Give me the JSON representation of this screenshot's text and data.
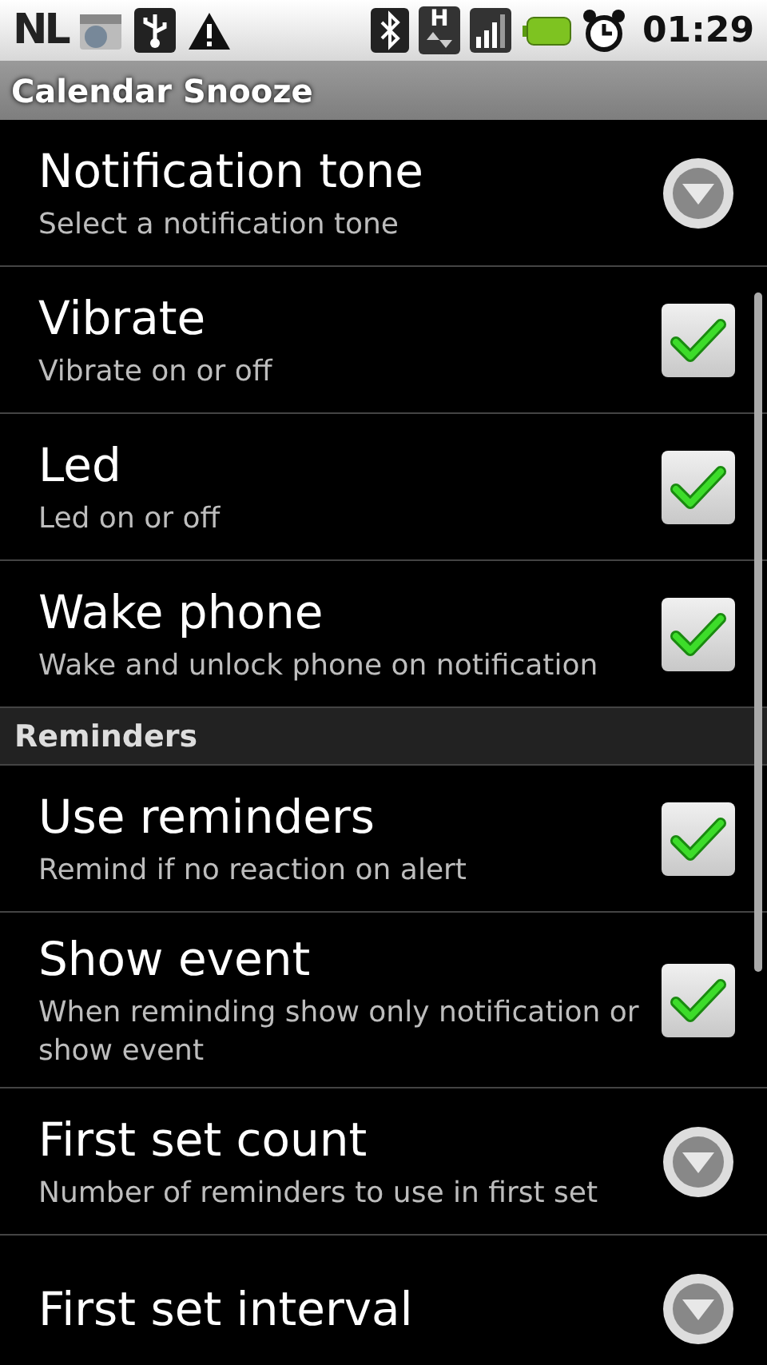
{
  "status_bar": {
    "carrier": "NL",
    "data_indicator": "H",
    "time": "01:29"
  },
  "title_bar": {
    "title": "Calendar Snooze"
  },
  "items": [
    {
      "kind": "list",
      "title": "Notification tone",
      "summary": "Select a notification tone"
    },
    {
      "kind": "checkbox",
      "title": "Vibrate",
      "summary": "Vibrate on or off",
      "checked": true
    },
    {
      "kind": "checkbox",
      "title": "Led",
      "summary": "Led on or off",
      "checked": true
    },
    {
      "kind": "checkbox",
      "title": "Wake phone",
      "summary": "Wake and unlock phone on notification",
      "checked": true
    },
    {
      "kind": "category",
      "title": "Reminders"
    },
    {
      "kind": "checkbox",
      "title": "Use reminders",
      "summary": "Remind if no reaction on alert",
      "checked": true
    },
    {
      "kind": "checkbox",
      "title": "Show event",
      "summary": "When reminding show only notification or show event",
      "checked": true
    },
    {
      "kind": "list",
      "title": "First set count",
      "summary": "Number of reminders to use in first set"
    },
    {
      "kind": "list",
      "title": "First set interval"
    }
  ]
}
